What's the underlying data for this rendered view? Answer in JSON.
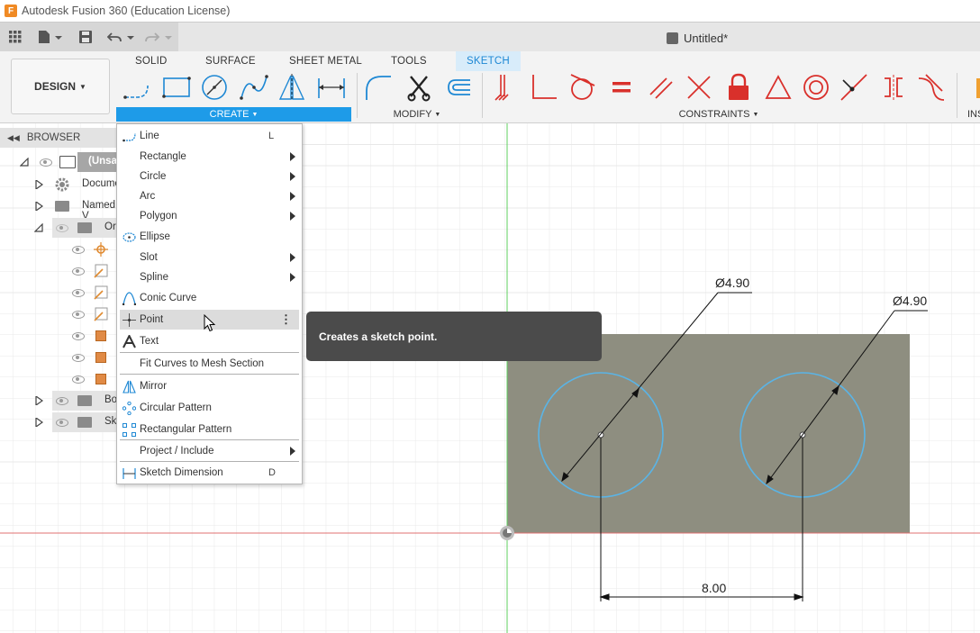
{
  "window": {
    "title": "Autodesk Fusion 360 (Education License)",
    "app_icon_letter": "F"
  },
  "document": {
    "tab_title": "Untitled*"
  },
  "workspace": {
    "label": "DESIGN"
  },
  "ribbon": {
    "tabs": [
      "SOLID",
      "SURFACE",
      "SHEET METAL",
      "TOOLS",
      "SKETCH"
    ],
    "active_tab": "SKETCH",
    "groups": {
      "create": "CREATE",
      "modify": "MODIFY",
      "constraints": "CONSTRAINTS",
      "inspect": "INS"
    }
  },
  "browser": {
    "header": "BROWSER",
    "items": [
      {
        "label": "(Unsa"
      },
      {
        "label": "Docume"
      },
      {
        "label": "Named V"
      },
      {
        "label": "Or"
      },
      {
        "label": "Bo"
      },
      {
        "label": "Sk"
      }
    ]
  },
  "create_menu": {
    "items": [
      {
        "label": "Line",
        "shortcut": "L"
      },
      {
        "label": "Rectangle"
      },
      {
        "label": "Circle"
      },
      {
        "label": "Arc"
      },
      {
        "label": "Polygon"
      },
      {
        "label": "Ellipse"
      },
      {
        "label": "Slot"
      },
      {
        "label": "Spline"
      },
      {
        "label": "Conic Curve"
      },
      {
        "label": "Point"
      },
      {
        "label": "Text"
      },
      {
        "label": "Fit Curves to Mesh Section"
      },
      {
        "label": "Mirror"
      },
      {
        "label": "Circular Pattern"
      },
      {
        "label": "Rectangular Pattern"
      },
      {
        "label": "Project / Include"
      },
      {
        "label": "Sketch Dimension",
        "shortcut": "D"
      }
    ],
    "hovered": "Point"
  },
  "tooltip": {
    "text": "Creates a sketch point."
  },
  "sketch": {
    "dim_diameter_left": "Ø4.90",
    "dim_diameter_right": "Ø4.90",
    "dim_distance": "8.00"
  },
  "colors": {
    "accent": "#1e9be8",
    "sketch_curve": "#5ab4e6",
    "constraint_red": "#d9302b",
    "body_fill": "#8e8e80"
  }
}
